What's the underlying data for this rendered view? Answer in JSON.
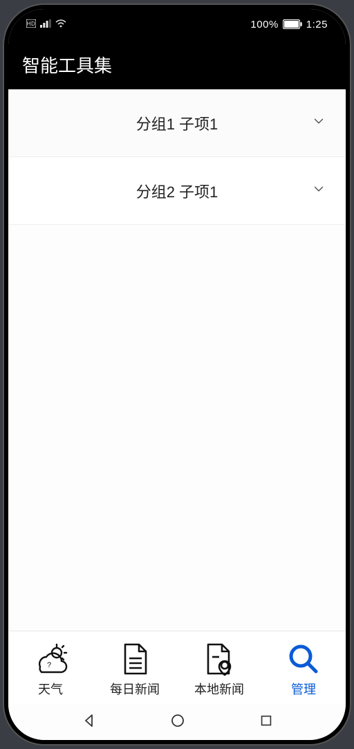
{
  "status": {
    "battery_pct": "100%",
    "time": "1:25"
  },
  "header": {
    "title": "智能工具集"
  },
  "list": {
    "items": [
      {
        "label": "分组1 子项1"
      },
      {
        "label": "分组2 子项1"
      }
    ]
  },
  "nav": {
    "items": [
      {
        "label": "天气",
        "icon": "weather-icon",
        "active": false
      },
      {
        "label": "每日新闻",
        "icon": "news-icon",
        "active": false
      },
      {
        "label": "本地新闻",
        "icon": "local-news-icon",
        "active": false
      },
      {
        "label": "管理",
        "icon": "manage-icon",
        "active": true
      }
    ]
  }
}
